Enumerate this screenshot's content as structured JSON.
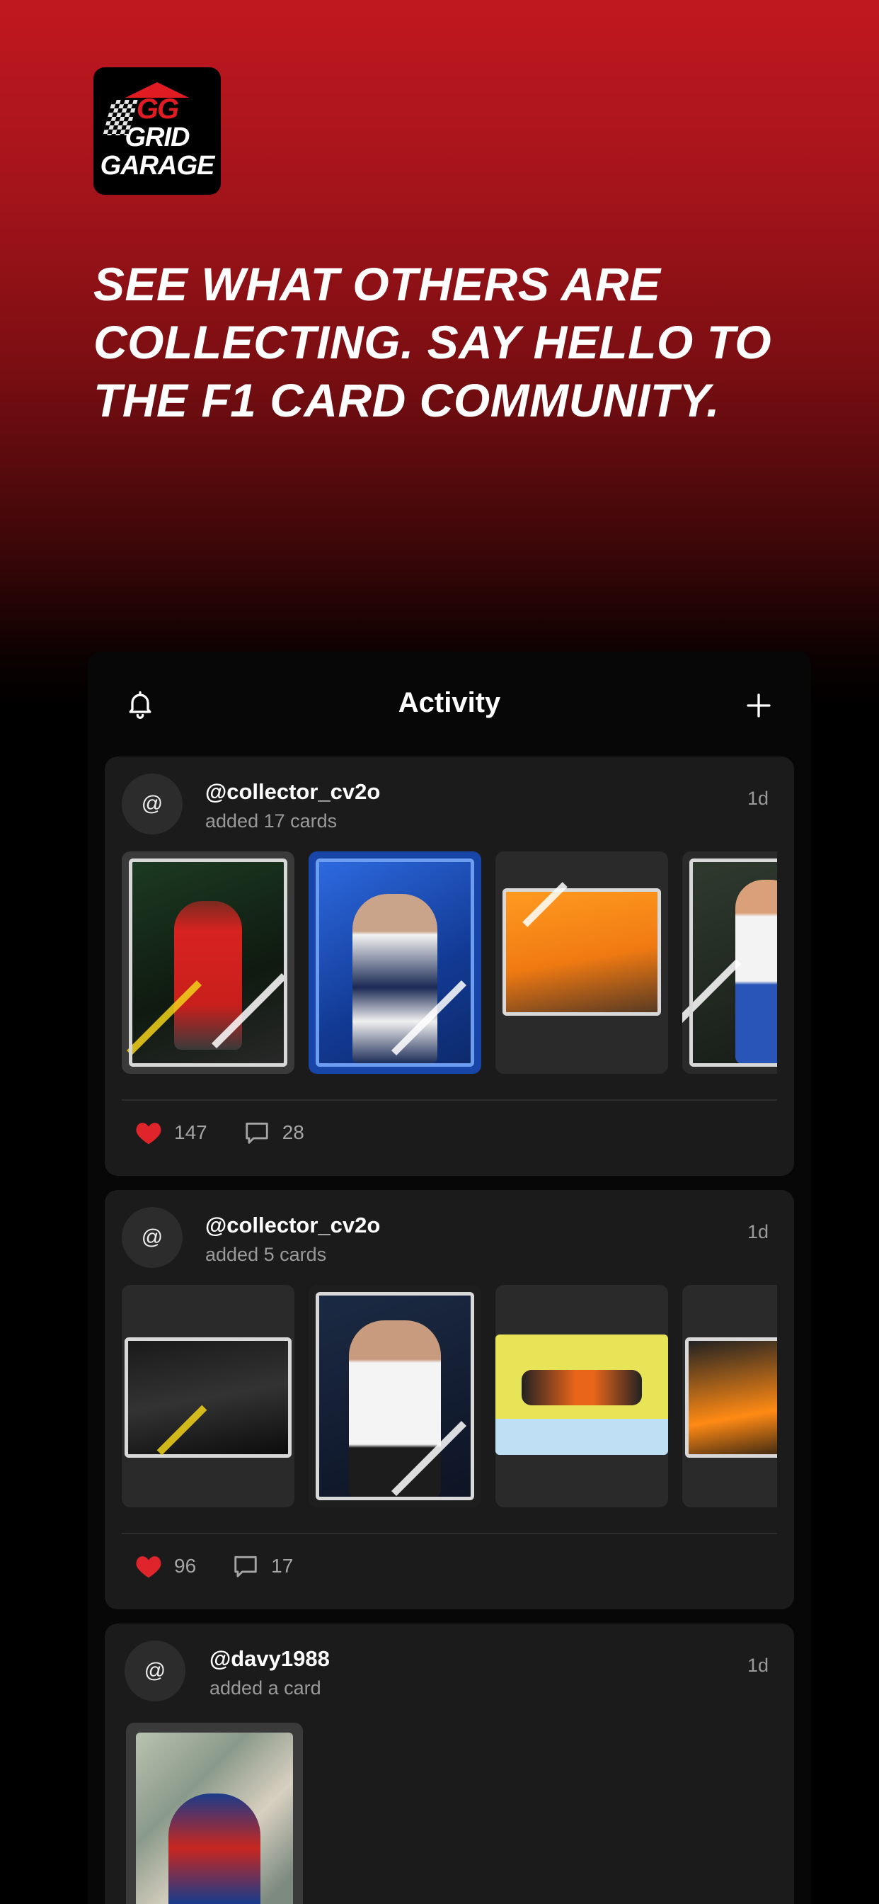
{
  "logo": {
    "monogram": "GG",
    "line1": "GRID",
    "line2": "GARAGE"
  },
  "headline": [
    "SEE WHAT OTHERS ARE",
    "COLLECTING. SAY HELLO TO",
    "THE F1 CARD COMMUNITY."
  ],
  "panel": {
    "title": "Activity"
  },
  "posts": [
    {
      "avatar": "@",
      "username": "@collector_cv2o",
      "action": "added 17 cards",
      "time": "1d",
      "likes": "147",
      "comments": "28"
    },
    {
      "avatar": "@",
      "username": "@collector_cv2o",
      "action": "added 5 cards",
      "time": "1d",
      "likes": "96",
      "comments": "17"
    },
    {
      "avatar": "@",
      "username": "@davy1988",
      "action": "added a card",
      "time": "1d"
    }
  ],
  "icons": {
    "bell": "bell-icon",
    "add": "plus-icon",
    "like": "heart-icon",
    "comment": "comment-icon"
  },
  "colors": {
    "brand": "#c1181f",
    "like": "#e0242b",
    "panel": "#070707",
    "card": "#1b1b1b"
  }
}
